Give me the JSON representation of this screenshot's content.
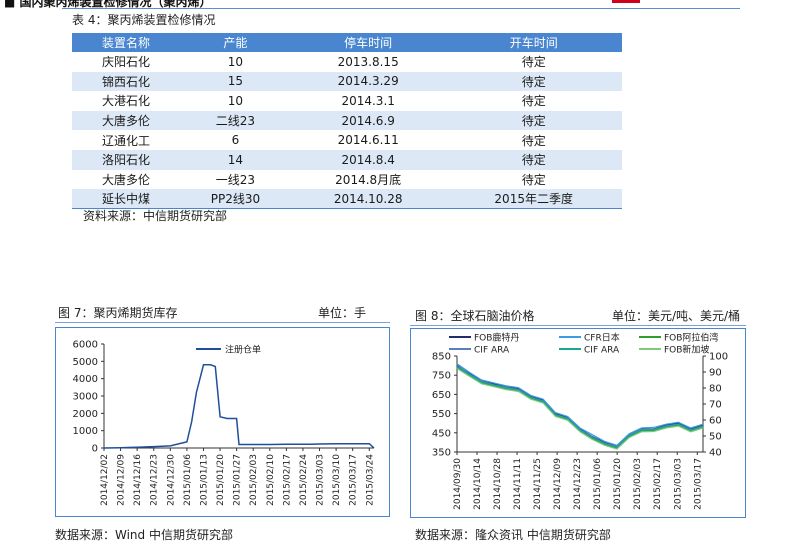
{
  "table": {
    "caption": "表 4：聚丙烯装置检修情况",
    "headers": [
      "装置名称",
      "产能",
      "停车时间",
      "开车时间"
    ],
    "rows": [
      [
        "庆阳石化",
        "10",
        "2013.8.15",
        "待定"
      ],
      [
        "锦西石化",
        "15",
        "2014.3.29",
        "待定"
      ],
      [
        "大港石化",
        "10",
        "2014.3.1",
        "待定"
      ],
      [
        "大唐多伦",
        "二线23",
        "2014.6.9",
        "待定"
      ],
      [
        "辽通化工",
        "6",
        "2014.6.11",
        "待定"
      ],
      [
        "洛阳石化",
        "14",
        "2014.8.4",
        "待定"
      ],
      [
        "大唐多伦",
        "一线23",
        "2014.8月底",
        "待定"
      ],
      [
        "延长中煤",
        "PP2线30",
        "2014.10.28",
        "2015年二季度"
      ]
    ],
    "source": "资料来源：中信期货研究部"
  },
  "figure7": {
    "caption": "图 7：聚丙烯期货库存",
    "unit": "单位：手",
    "source": "数据来源：Wind  中信期货研究部"
  },
  "figure8": {
    "caption": "图 8：全球石脑油价格",
    "unit": "单位：美元/吨、美元/桶",
    "source": "数据来源：隆众资讯  中信期货研究部"
  },
  "chart_data": [
    {
      "type": "line",
      "series": [
        {
          "name": "注册仓单",
          "color": "#1f4e9c",
          "x": [
            "2014/12/02",
            "2014/12/09",
            "2014/12/16",
            "2014/12/23",
            "2014/12/30",
            "2015/01/06",
            "2015/01/08",
            "2015/01/10",
            "2015/01/13",
            "2015/01/16",
            "2015/01/18",
            "2015/01/20",
            "2015/01/23",
            "2015/01/27",
            "2015/01/28",
            "2015/02/03",
            "2015/02/10",
            "2015/02/17",
            "2015/02/27",
            "2015/03/03",
            "2015/03/10",
            "2015/03/17",
            "2015/03/24",
            "2015/03/26"
          ],
          "values": [
            0,
            20,
            40,
            80,
            120,
            350,
            1500,
            3200,
            4800,
            4800,
            4700,
            1800,
            1700,
            1700,
            200,
            200,
            200,
            220,
            220,
            230,
            250,
            250,
            250,
            0
          ]
        }
      ],
      "x_ticks": [
        "2014/12/02",
        "2014/12/09",
        "2014/12/16",
        "2014/12/23",
        "2014/12/30",
        "2015/01/06",
        "2015/01/13",
        "2015/01/20",
        "2015/01/27",
        "2015/02/03",
        "2015/02/10",
        "2015/02/17",
        "2015/02/24",
        "2015/03/03",
        "2015/03/10",
        "2015/03/17",
        "2015/03/24"
      ],
      "ylim": [
        0,
        6000
      ],
      "y_ticks": [
        0,
        1000,
        2000,
        3000,
        4000,
        5000,
        6000
      ],
      "legend": "top"
    },
    {
      "type": "line",
      "x_ticks": [
        "2014/09/30",
        "2014/10/14",
        "2014/10/28",
        "2014/11/11",
        "2014/11/25",
        "2014/12/09",
        "2014/12/23",
        "2015/01/06",
        "2015/01/20",
        "2015/02/03",
        "2015/02/17",
        "2015/03/03",
        "2015/03/17"
      ],
      "ylim_left": [
        350,
        850
      ],
      "y_ticks_left": [
        350,
        450,
        550,
        650,
        750,
        850
      ],
      "ylim_right": [
        40,
        100
      ],
      "y_ticks_right": [
        40,
        50,
        60,
        70,
        80,
        90,
        100
      ],
      "legend": "top",
      "series": [
        {
          "name": "FOB鹿特丹",
          "color": "#1f2f6b",
          "axis": "left",
          "values": [
            800,
            760,
            720,
            705,
            690,
            680,
            640,
            620,
            550,
            530,
            470,
            430,
            400,
            380,
            440,
            470,
            470,
            490,
            500,
            470,
            490
          ]
        },
        {
          "name": "CFR日本",
          "color": "#3a9be6",
          "axis": "left",
          "values": [
            810,
            765,
            725,
            710,
            695,
            685,
            645,
            625,
            555,
            535,
            475,
            440,
            405,
            385,
            445,
            475,
            478,
            495,
            505,
            475,
            495
          ]
        },
        {
          "name": "FOB阿拉伯湾",
          "color": "#2ca02c",
          "axis": "left",
          "values": [
            790,
            750,
            710,
            695,
            680,
            670,
            630,
            610,
            540,
            520,
            460,
            420,
            390,
            370,
            430,
            460,
            462,
            480,
            490,
            460,
            480
          ]
        },
        {
          "name": "CIF ARA",
          "color": "#5a7fbf",
          "axis": "left",
          "values": [
            805,
            755,
            718,
            700,
            688,
            676,
            636,
            616,
            546,
            526,
            466,
            428,
            396,
            378,
            438,
            468,
            468,
            486,
            496,
            466,
            486
          ]
        },
        {
          "name": "CIF ARA",
          "color": "#1aa88a",
          "axis": "left",
          "values": [
            795,
            752,
            714,
            698,
            684,
            672,
            634,
            613,
            544,
            523,
            463,
            424,
            393,
            374,
            434,
            464,
            465,
            483,
            493,
            463,
            483
          ]
        },
        {
          "name": "FOB新加坡",
          "color": "#7fc97f",
          "axis": "left",
          "values": [
            785,
            745,
            705,
            690,
            675,
            665,
            625,
            605,
            535,
            515,
            455,
            415,
            385,
            365,
            425,
            455,
            457,
            475,
            485,
            455,
            475
          ]
        }
      ]
    }
  ]
}
